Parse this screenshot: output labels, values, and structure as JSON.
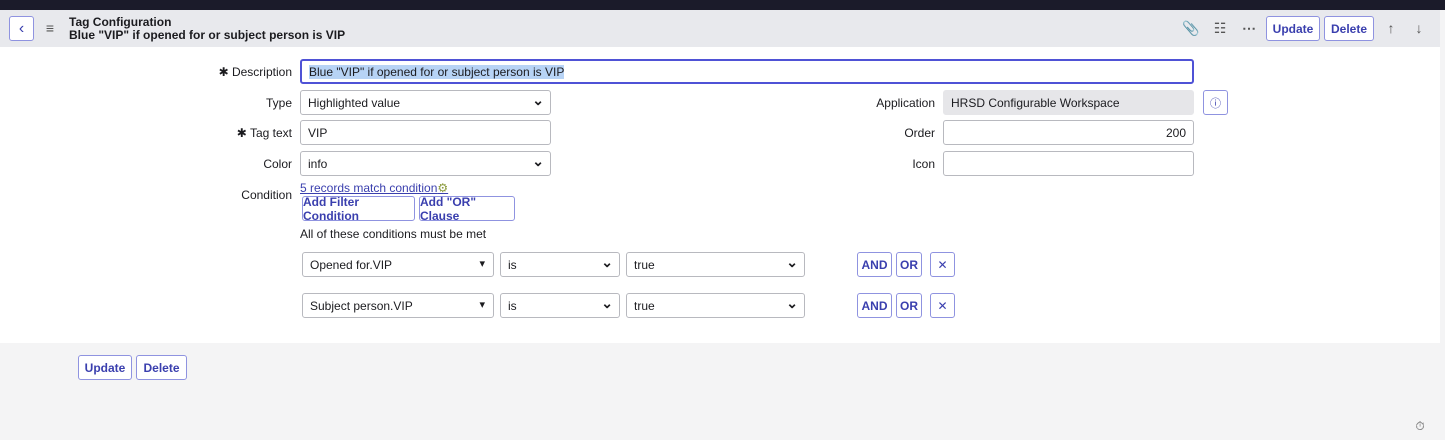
{
  "header": {
    "title": "Tag Configuration",
    "subtitle": "Blue \"VIP\" if opened for or subject person is VIP",
    "update": "Update",
    "delete": "Delete"
  },
  "form": {
    "description": {
      "label": "Description",
      "value": "Blue \"VIP\" if opened for or subject person is VIP"
    },
    "type": {
      "label": "Type",
      "value": "Highlighted value"
    },
    "tag_text": {
      "label": "Tag text",
      "value": "VIP"
    },
    "color": {
      "label": "Color",
      "value": "info"
    },
    "application": {
      "label": "Application",
      "value": "HRSD Configurable Workspace"
    },
    "order": {
      "label": "Order",
      "value": "200"
    },
    "icon": {
      "label": "Icon",
      "value": ""
    },
    "condition": {
      "label": "Condition",
      "match_link": "5 records match condition",
      "add_filter": "Add Filter Condition",
      "add_or": "Add \"OR\" Clause",
      "all_met": "All of these conditions must be met",
      "rows": [
        {
          "field": "Opened for.VIP",
          "operator": "is",
          "value": "true"
        },
        {
          "field": "Subject person.VIP",
          "operator": "is",
          "value": "true"
        }
      ],
      "and": "AND",
      "or": "OR"
    }
  },
  "footer": {
    "update": "Update",
    "delete": "Delete"
  },
  "colors": {
    "accent": "#3a3fae",
    "focus": "#4f52d6"
  }
}
